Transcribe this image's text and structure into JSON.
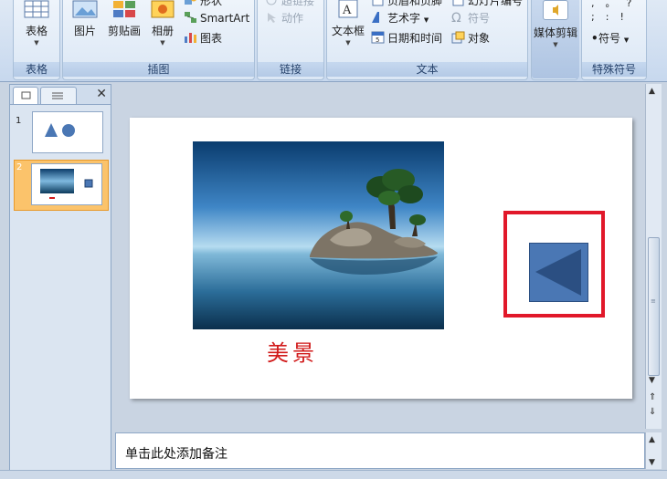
{
  "ribbon": {
    "groups": {
      "table": {
        "label": "表格",
        "button": "表格"
      },
      "illustrations": {
        "label": "插图",
        "picture": "图片",
        "clipart": "剪贴画",
        "album": "相册",
        "shapes": "形状",
        "smartart": "SmartArt",
        "chart": "图表"
      },
      "links": {
        "label": "链接",
        "hyperlink": "超链接",
        "action": "动作"
      },
      "text": {
        "label": "文本",
        "textbox": "文本框",
        "header_footer": "页眉和页脚",
        "wordart": "艺术字",
        "datetime": "日期和时间",
        "slide_number": "幻灯片编号",
        "symbol": "符号",
        "object": "对象"
      },
      "media": {
        "label": "",
        "button": "媒体剪辑"
      },
      "special": {
        "label": "特殊符号",
        "symbol_button": "符号"
      }
    }
  },
  "left_panel": {
    "slides": [
      {
        "number": "1"
      },
      {
        "number": "2"
      }
    ]
  },
  "slide": {
    "caption": "美景"
  },
  "notes": {
    "placeholder": "单击此处添加备注"
  },
  "colors": {
    "accent_red": "#e1182a",
    "caption_red": "#d11a1a",
    "button_blue": "#4a77b4",
    "selection_orange": "#fbc36b"
  }
}
